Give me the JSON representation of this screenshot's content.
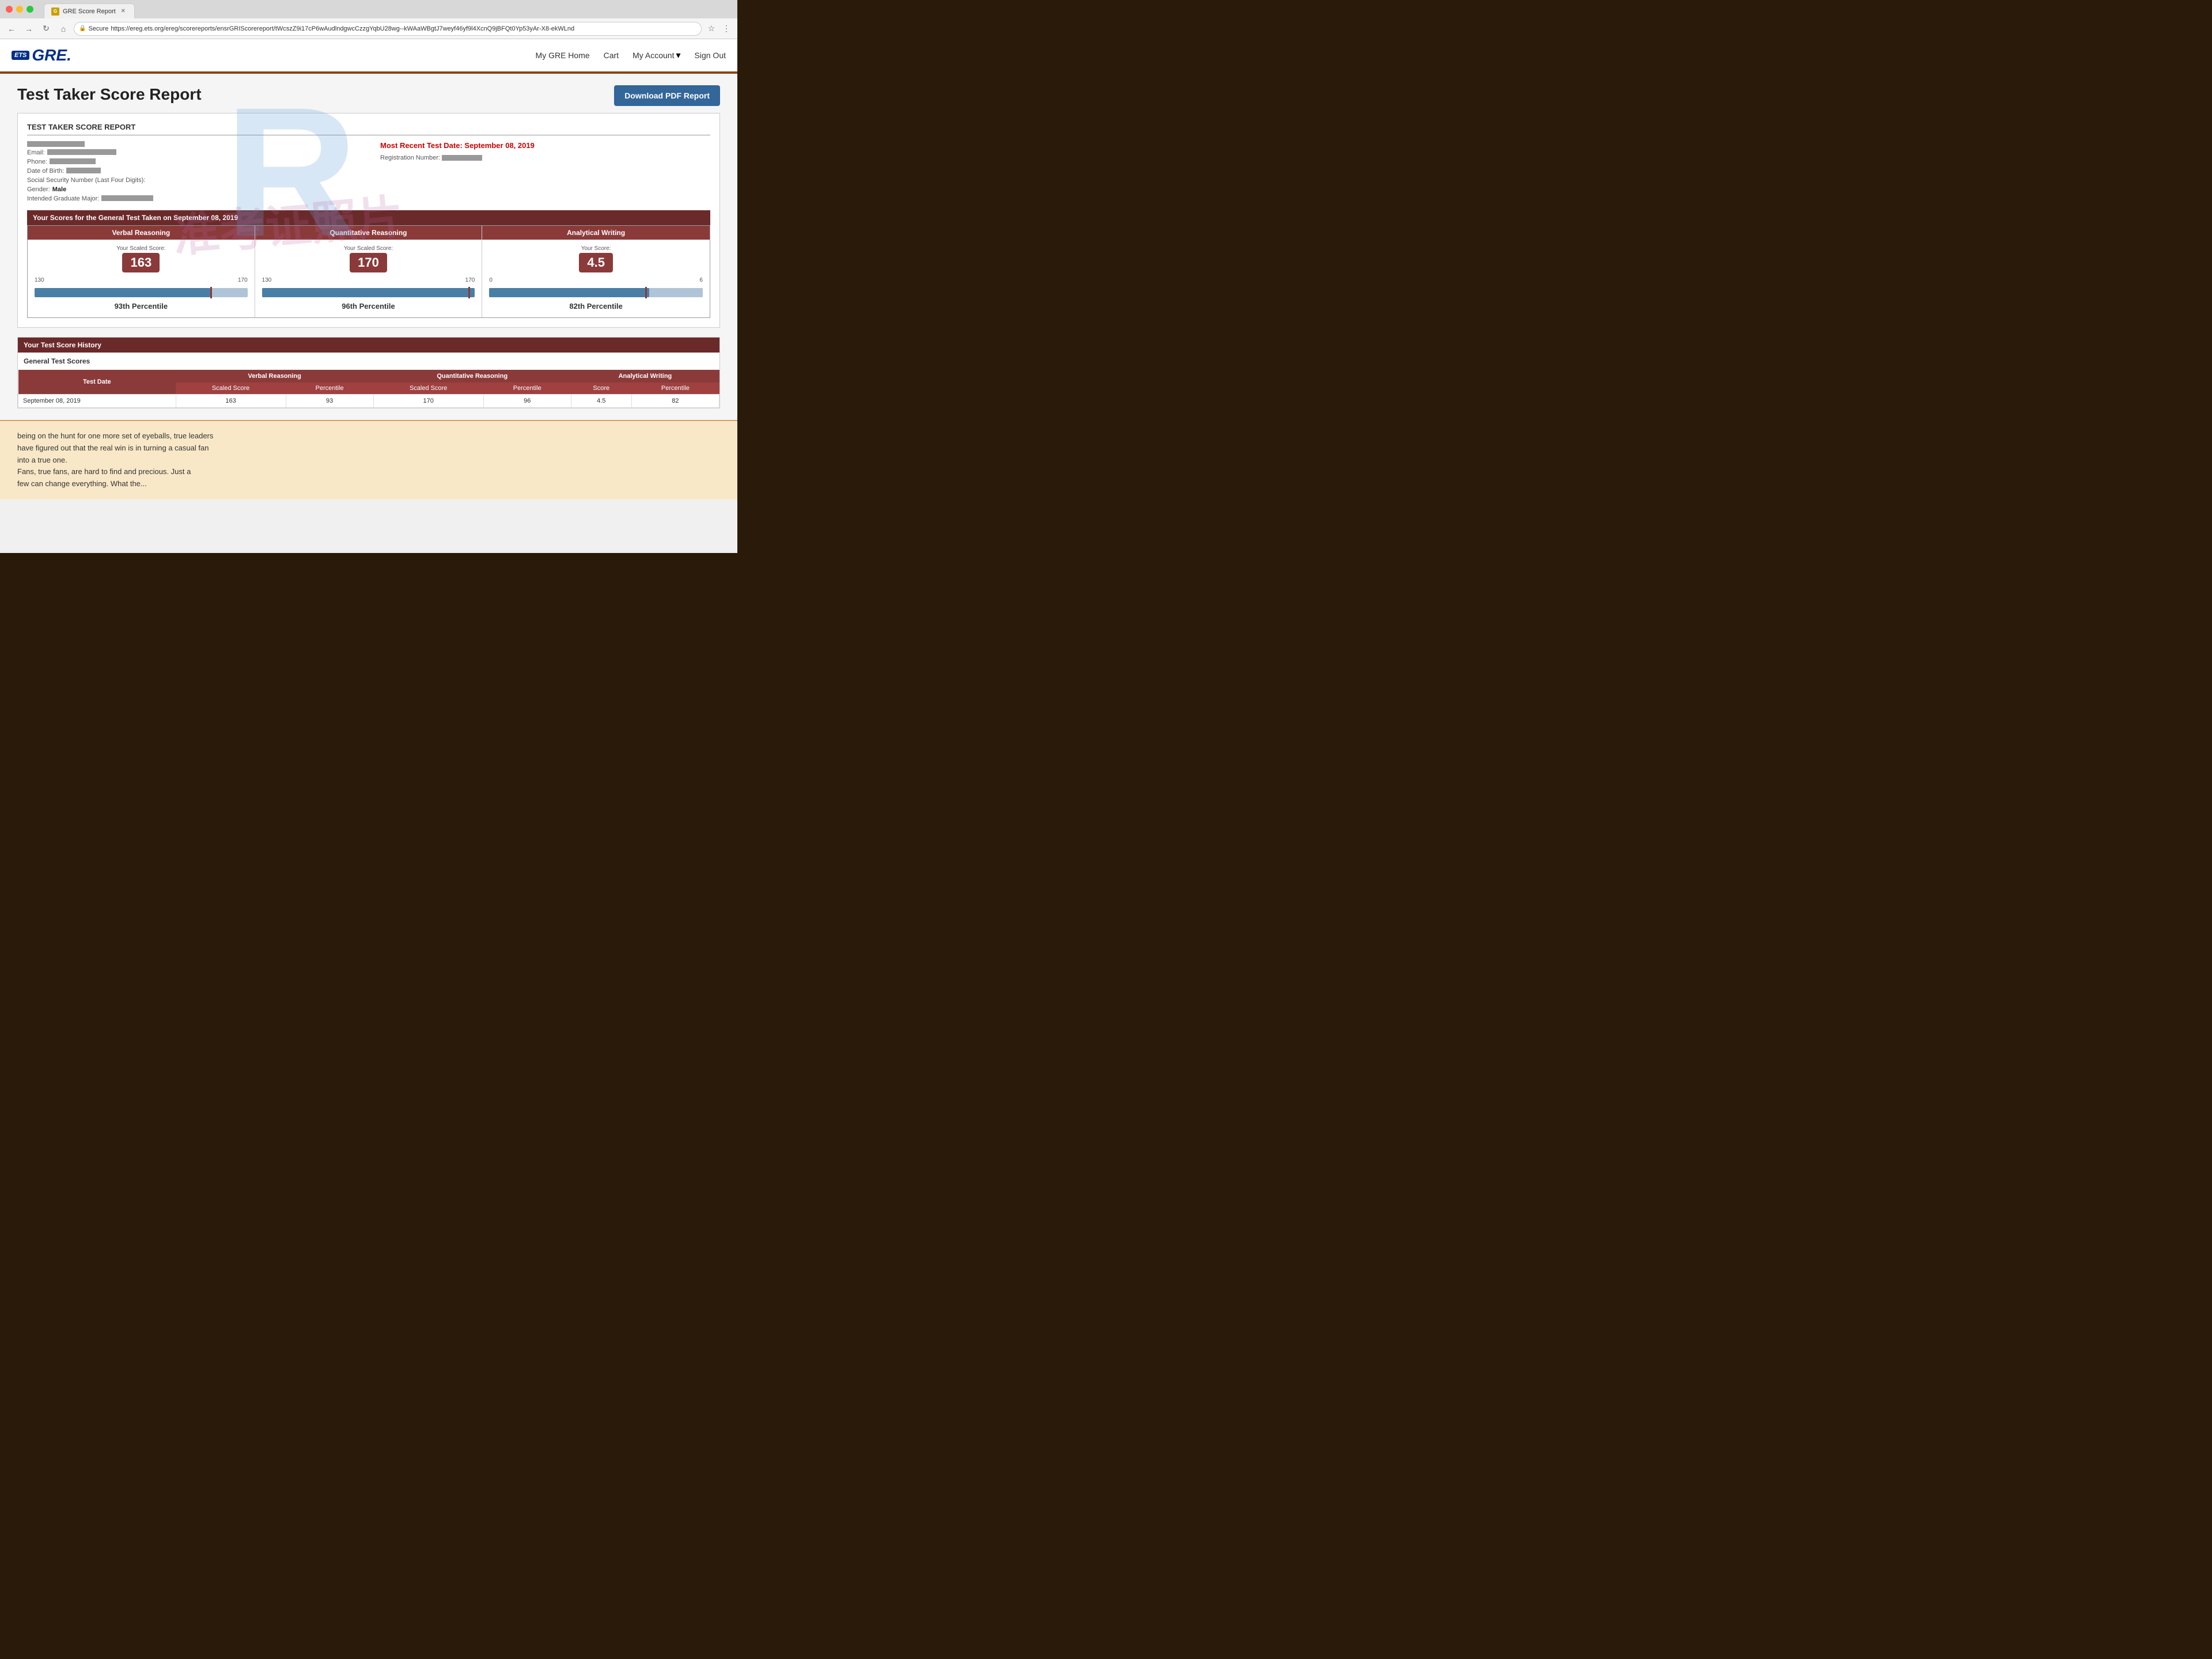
{
  "browser": {
    "tab_title": "GRE Score Report",
    "tab_favicon": "G",
    "url": "https://ereg.ets.org/ereg/scorereports/ensrGRIScorereport/tWcszZ9i17cP6wAudlndgwcCzzgYqbU28wg--kWAaWBgtJ7weyf46yf9l4XcnQ9jBFQt0Yp53yAr-X8-ekWLnd",
    "secure_label": "Secure"
  },
  "nav": {
    "my_gre_home": "My GRE Home",
    "cart": "Cart",
    "my_account": "My Account",
    "sign_out": "Sign Out"
  },
  "logo": {
    "ets": "ETS",
    "gre": "GRE."
  },
  "page": {
    "title": "Test Taker Score Report",
    "download_btn": "Download PDF Report",
    "score_report_section_title": "TEST TAKER SCORE REPORT",
    "most_recent_date_label": "Most Recent Test Date: ",
    "most_recent_date_value": "September 08, 2019",
    "registration_label": "Registration Number:",
    "email_label": "Email:",
    "phone_label": "Phone:",
    "dob_label": "Date of Birth:",
    "ssn_label": "Social Security Number (Last Four Digits):",
    "gender_label": "Gender:",
    "gender_value": "Male",
    "grad_major_label": "Intended Graduate Major:",
    "general_test_header": "Your Scores for the General Test Taken on September 08, 2019",
    "verbal_header": "Verbal Reasoning",
    "quantitative_header": "Quantitative Reasoning",
    "analytical_header": "Analytical Writing",
    "verbal_score_label": "Your Scaled Score:",
    "verbal_score": "163",
    "verbal_min": "130",
    "verbal_max": "170",
    "verbal_percentile": "93rd",
    "verbal_percentile_full": "93th Percentile",
    "quant_score_label": "Your Scaled Score:",
    "quant_score": "170",
    "quant_min": "130",
    "quant_max": "170",
    "quant_percentile": "96th",
    "quant_percentile_full": "96th Percentile",
    "aw_score_label": "Your Score:",
    "aw_score": "4.5",
    "aw_min": "0",
    "aw_max": "6",
    "aw_percentile": "82nd",
    "aw_percentile_full": "82th Percentile",
    "history_header": "Your Test Score History",
    "general_test_scores": "General Test Scores",
    "col_test_date": "Test Date",
    "col_verbal": "Verbal Reasoning",
    "col_quant": "Quantitative Reasoning",
    "col_aw": "Analytical Writing",
    "col_scaled_score": "Scaled Score",
    "col_percentile": "Percentile",
    "col_aw_score": "Score",
    "col_aw_percentile": "Percentile",
    "row1_date": "September 08, 2019",
    "row1_verbal_score": "163",
    "row1_verbal_pct": "93",
    "row1_quant_score": "170",
    "row1_quant_pct": "96",
    "row1_aw_score": "4.5",
    "row1_aw_pct": "82"
  },
  "book_text": {
    "line1": "being on the hunt for one more set of eyeballs, true leaders",
    "line2": "have figured out that the real win is in turning a casual fan",
    "line3": "into a true one.",
    "line4": "Fans, true fans, are hard to find and precious. Just a",
    "line5": "few can change everything. What the..."
  },
  "watermark": {
    "r_letter": "R",
    "text": "准考证照片"
  }
}
